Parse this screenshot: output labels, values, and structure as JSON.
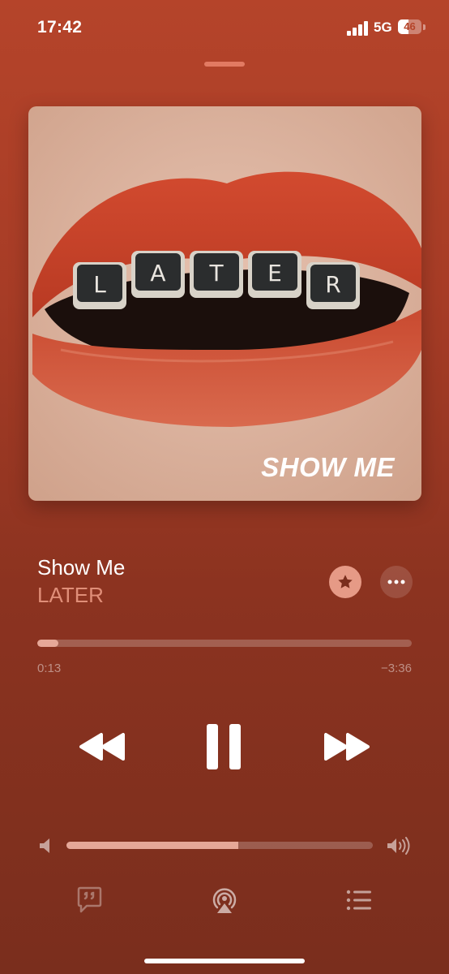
{
  "status_bar": {
    "time": "17:42",
    "network": "5G",
    "battery_level": 46,
    "battery_label": "46",
    "signal_icon": "cellular-signal-icon"
  },
  "artwork": {
    "overlay_text": "SHOW ME",
    "key_letters": [
      "L",
      "A",
      "T",
      "E",
      "R"
    ],
    "lip_color": "#c9412a",
    "skin_color": "#d9b3a0"
  },
  "track": {
    "title": "Show Me",
    "artist": "LATER"
  },
  "actions": {
    "favorite_icon": "star-icon",
    "more_icon": "ellipsis-icon"
  },
  "progress": {
    "elapsed": "0:13",
    "remaining": "−3:36",
    "fraction": 0.057
  },
  "transport": {
    "rewind_icon": "rewind-icon",
    "pause_icon": "pause-icon",
    "forward_icon": "fast-forward-icon"
  },
  "volume": {
    "fraction": 0.56,
    "low_icon": "speaker-low-icon",
    "high_icon": "speaker-high-icon"
  },
  "bottom_bar": {
    "lyrics_icon": "lyrics-icon",
    "airplay_icon": "airplay-icon",
    "queue_icon": "queue-list-icon"
  },
  "colors": {
    "background": "#a73c26",
    "accent": "#e6a898",
    "artist_text": "#e08e78"
  }
}
